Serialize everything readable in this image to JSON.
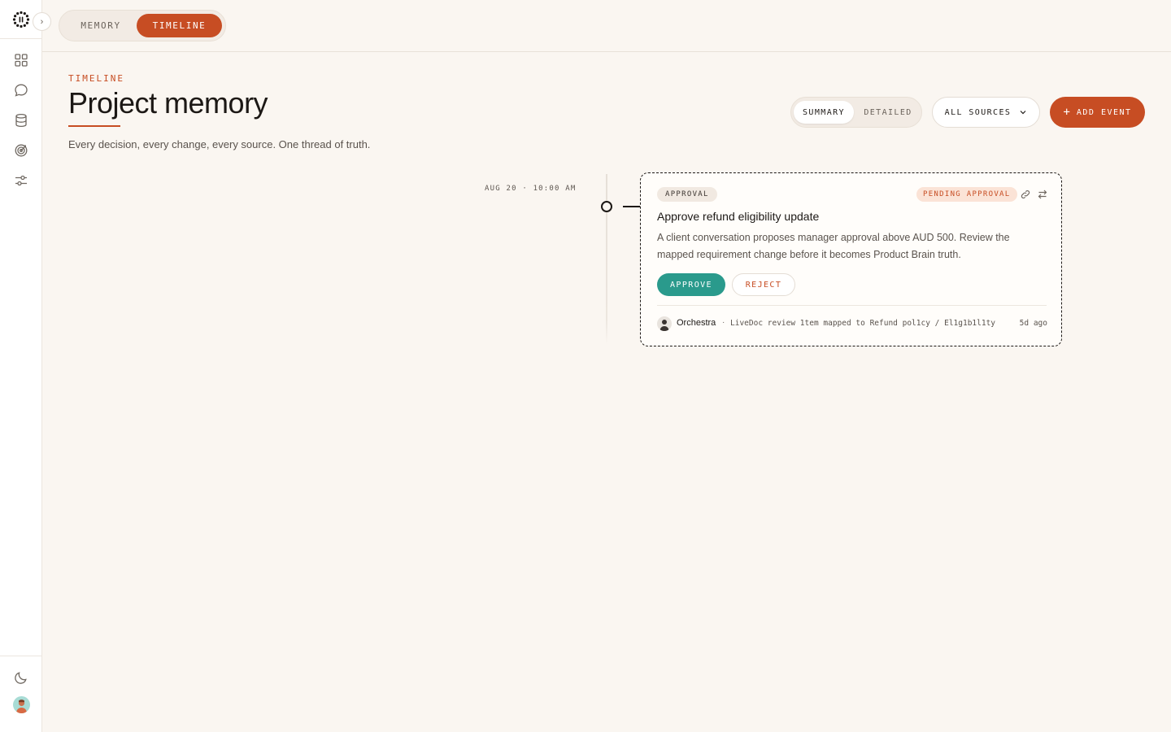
{
  "sidebar": {
    "nav_icons": [
      "grid-icon",
      "chat-icon",
      "database-icon",
      "target-icon",
      "sliders-icon"
    ],
    "bottom_icons": [
      "moon-icon",
      "user-avatar"
    ]
  },
  "topbar": {
    "tabs": [
      {
        "label": "MEMORY",
        "active": false
      },
      {
        "label": "TIMELINE",
        "active": true
      }
    ]
  },
  "header": {
    "eyebrow": "TIMELINE",
    "title": "Project memory",
    "subtitle": "Every decision, every change, every source. One thread of truth."
  },
  "controls": {
    "density_options": [
      {
        "label": "SUMMARY",
        "active": true
      },
      {
        "label": "DETAILED",
        "active": false
      }
    ],
    "source_filter": "ALL SOURCES",
    "add_event_label": "ADD EVENT"
  },
  "events": [
    {
      "date": "AUG 20 · 10:00 AM",
      "type": "APPROVAL",
      "status": "PENDING APPROVAL",
      "title": "Approve refund eligibility update",
      "description": "A client conversation proposes manager approval above AUD 500. Review the mapped requirement change before it becomes Product Brain truth.",
      "approve_label": "APPROVE",
      "reject_label": "REJECT",
      "author": "Orchestra",
      "meta": "LiveDoc review 1tem mapped to Refund pol1cy / El1g1b1l1ty",
      "time_ago": "5d ago"
    }
  ],
  "colors": {
    "accent": "#c74d23",
    "approve": "#2a9a8c",
    "background": "#faf6f1"
  }
}
